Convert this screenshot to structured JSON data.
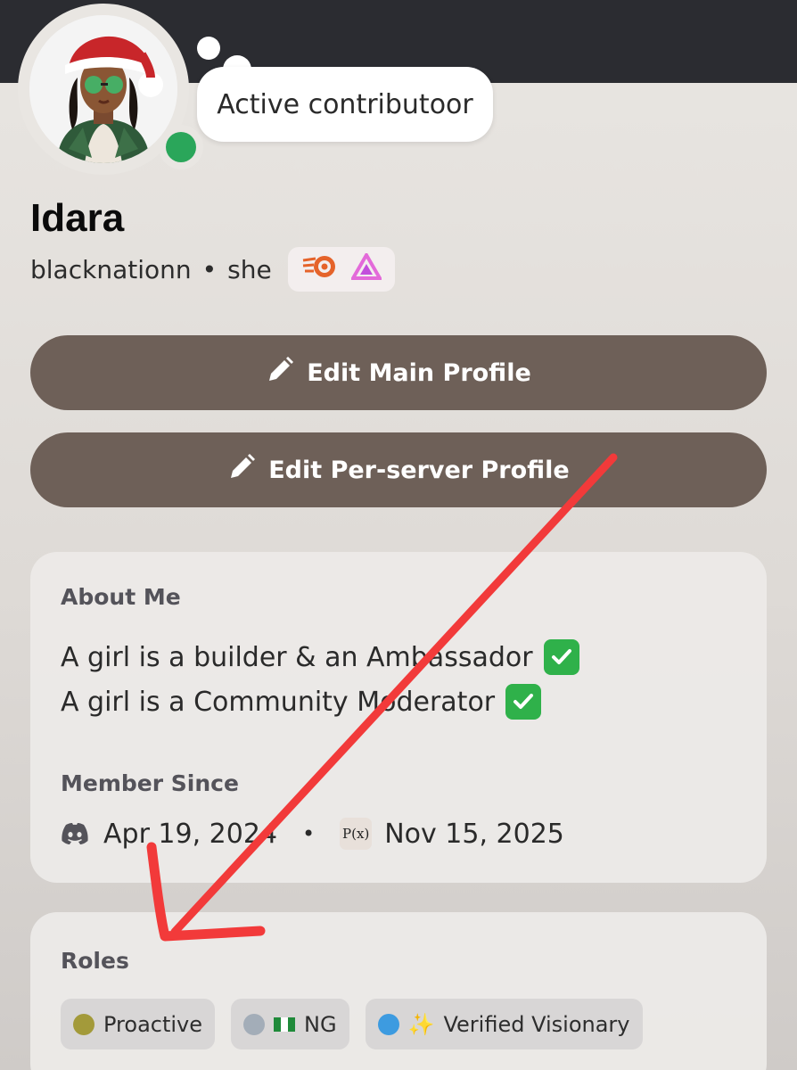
{
  "status_bubble": {
    "text": "Active contributoor"
  },
  "profile": {
    "display_name": "Idara",
    "username": "blacknationn",
    "separator": "•",
    "pronouns": "she",
    "badges": [
      "orange-swirl-badge-icon",
      "pink-triangle-badge-icon"
    ]
  },
  "buttons": {
    "edit_main": "Edit Main Profile",
    "edit_server": "Edit Per-server Profile"
  },
  "about": {
    "title": "About Me",
    "lines": [
      "A girl is a builder & an Ambassador",
      "A girl is a Community Moderator"
    ],
    "check_glyph": "✓"
  },
  "member_since": {
    "title": "Member Since",
    "discord_date": "Apr 19, 2024",
    "separator": "•",
    "server_badge": "P(x)",
    "server_date": "Nov 15, 2025"
  },
  "roles": {
    "title": "Roles",
    "items": [
      {
        "label": "Proactive",
        "prefix": "",
        "color": "#a39a3a"
      },
      {
        "label": "NG",
        "prefix": "",
        "color": "#a3adb8"
      },
      {
        "label": "Verified Visionary",
        "prefix": "✨",
        "color": "#3d9be0"
      }
    ]
  },
  "colors": {
    "banner": "#2b2c31",
    "button": "#6e6058",
    "online_status": "#2aa65a",
    "annotation_arrow": "#f23a3a"
  }
}
